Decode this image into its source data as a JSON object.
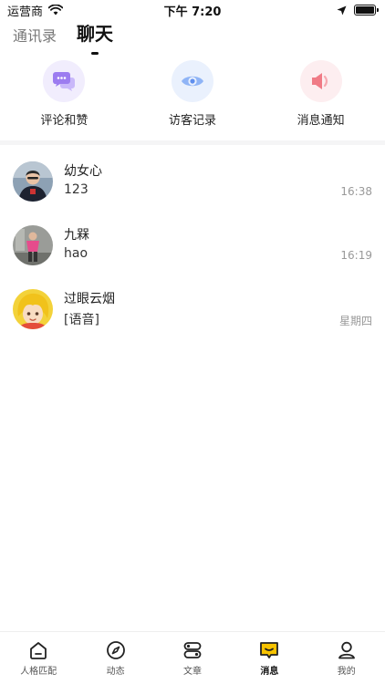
{
  "status_bar": {
    "carrier": "运营商",
    "time": "下午 7:20",
    "icons": [
      "wifi-icon",
      "location-arrow-icon",
      "battery-icon"
    ]
  },
  "top_tabs": [
    {
      "label": "通讯录",
      "active": false
    },
    {
      "label": "聊天",
      "active": true
    }
  ],
  "quick_actions": [
    {
      "label": "评论和赞",
      "icon": "chat-bubbles-icon",
      "bg": "#f1edfd",
      "color": "#9c7cf0"
    },
    {
      "label": "访客记录",
      "icon": "eye-icon",
      "bg": "#eaf1fd",
      "color": "#6e9cf2"
    },
    {
      "label": "消息通知",
      "icon": "speaker-icon",
      "bg": "#fdeef0",
      "color": "#f07b86"
    }
  ],
  "chats": [
    {
      "name": "幼女心",
      "message": "123",
      "time": "16:38",
      "avatar": "avatar-person-dark"
    },
    {
      "name": "九槑",
      "message": "hao",
      "time": "16:19",
      "avatar": "avatar-person-pink"
    },
    {
      "name": "过眼云烟",
      "message": "[语音]",
      "time": "星期四",
      "avatar": "avatar-cartoon-blonde"
    }
  ],
  "tabbar": [
    {
      "label": "人格匹配",
      "icon": "home-icon",
      "active": false
    },
    {
      "label": "动态",
      "icon": "compass-icon",
      "active": false
    },
    {
      "label": "文章",
      "icon": "toggles-icon",
      "active": false
    },
    {
      "label": "消息",
      "icon": "message-icon",
      "active": true
    },
    {
      "label": "我的",
      "icon": "profile-icon",
      "active": false
    }
  ],
  "colors": {
    "accent": "#f7c300",
    "text": "#222222",
    "muted": "#999999"
  }
}
